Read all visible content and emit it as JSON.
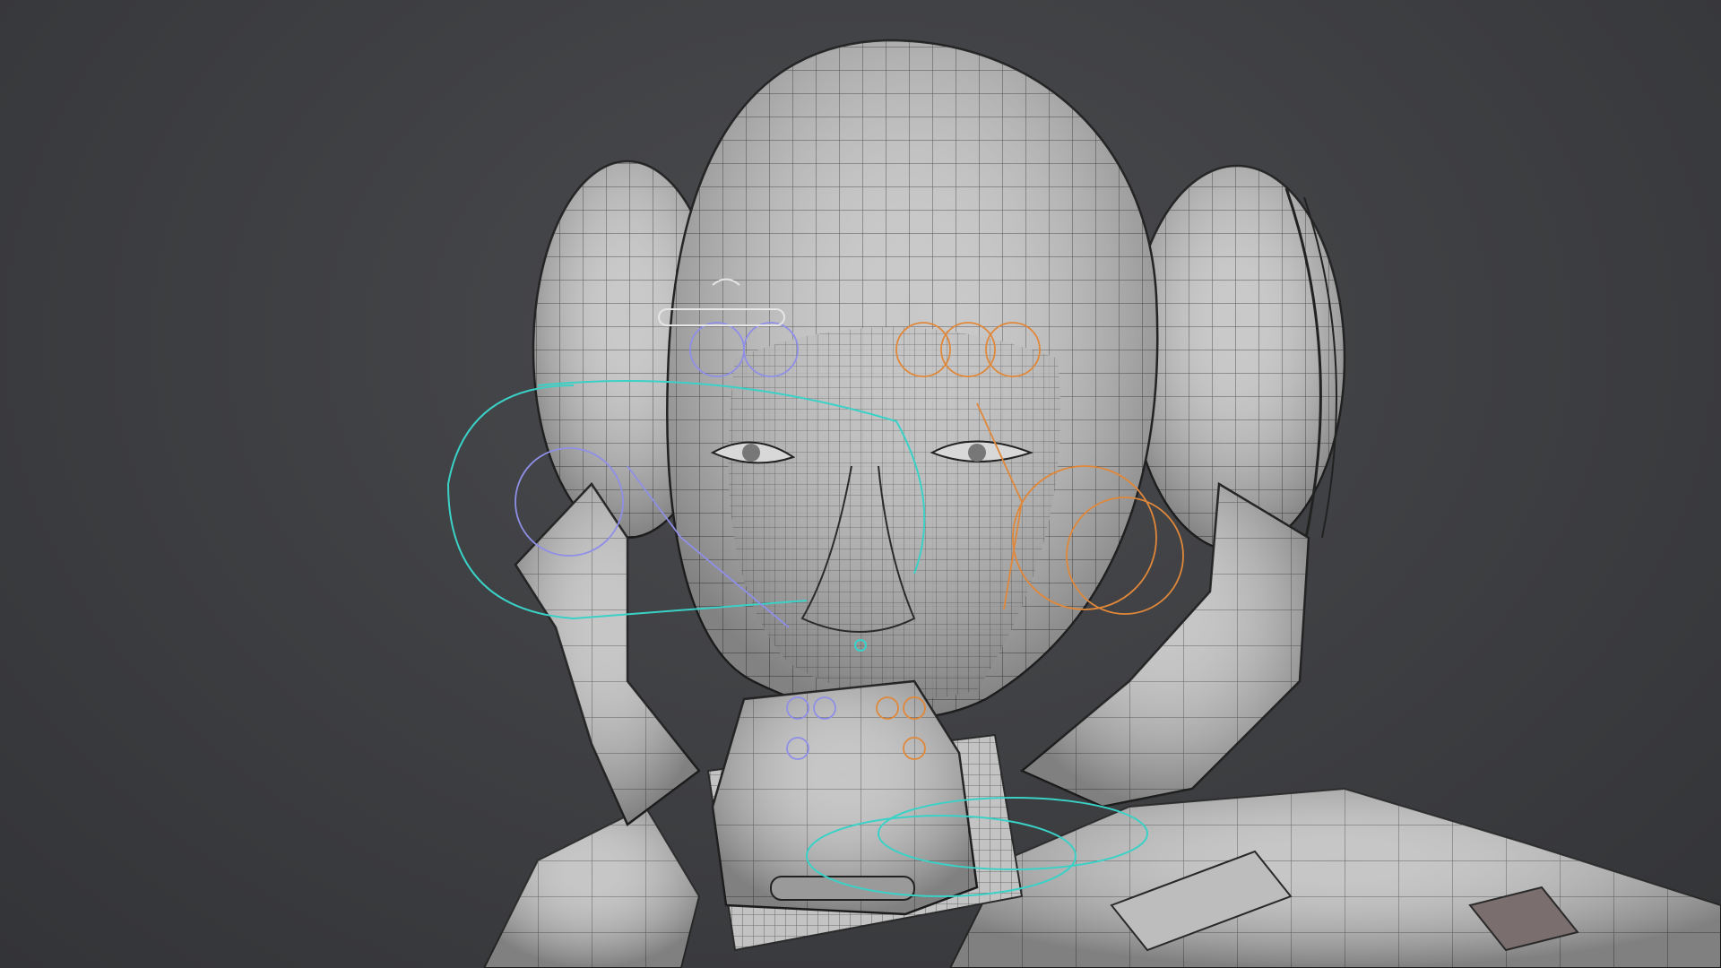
{
  "viewport": {
    "background_color": "#3d3e41",
    "mesh_fill_color": "#c9c9c9",
    "wire_color": "#4a4a4a",
    "rig_colors": {
      "left_side": "#8f8fe8",
      "right_side": "#e0883a",
      "center": "#3ad1c6",
      "neutral": "#e6e6e6"
    }
  },
  "model": {
    "parts": [
      "head",
      "left-ear-cup",
      "right-ear-cup",
      "left-jaw-guard",
      "right-jaw-guard",
      "mouth-guard",
      "neck",
      "shoulder-armor-left",
      "shoulder-armor-right"
    ]
  }
}
